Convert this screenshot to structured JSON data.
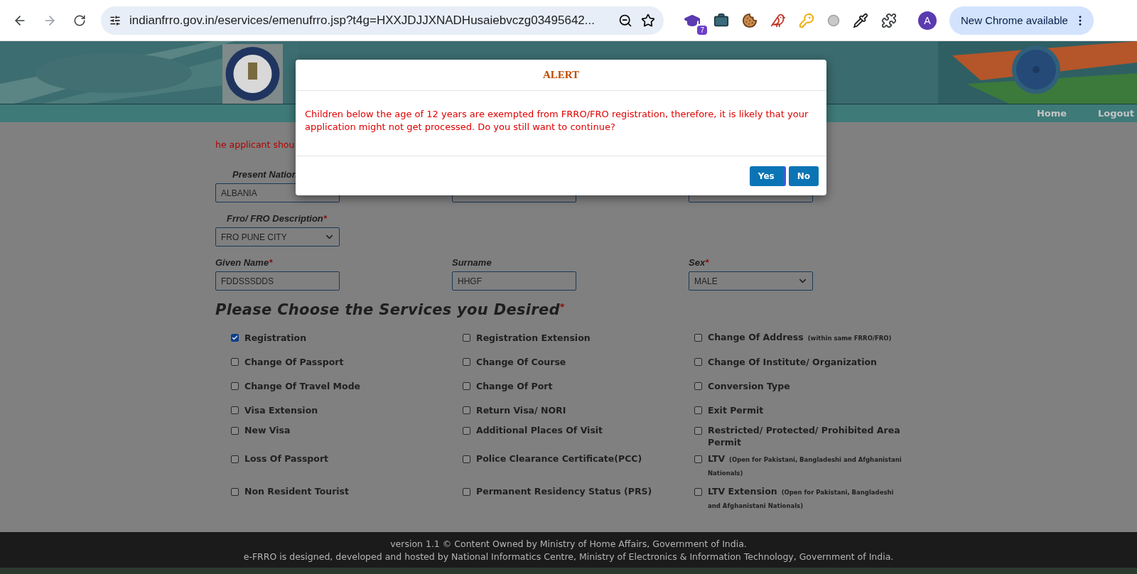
{
  "browser": {
    "url": "indianfrro.gov.in/eservices/emenufrro.jsp?t4g=HXXJDJJXNADHusaiebvczg03495642...",
    "extension_badge": "7",
    "avatar": "A",
    "update_button": "New Chrome available"
  },
  "nav": [
    {
      "label": "Home"
    },
    {
      "label": "Logout"
    }
  ],
  "notice": "he applicant shou",
  "fields": [
    {
      "kind": "input",
      "label": "Present Nation",
      "value": "ALBANIA"
    },
    {
      "kind": "input"
    },
    {
      "kind": "input"
    },
    {
      "kind": "select",
      "label": "Frro/ FRO Description",
      "required_mark": "*",
      "value": "FRO PUNE CITY"
    },
    {
      "kind": "none"
    },
    {
      "kind": "none"
    },
    {
      "kind": "input",
      "label": "Given Name",
      "required_mark": "*",
      "value": "FDDSSSDDS"
    },
    {
      "kind": "input",
      "label": "Surname",
      "value": "HHGF"
    },
    {
      "kind": "select",
      "label": "Sex",
      "required_mark": "*",
      "value": "MALE"
    }
  ],
  "services": {
    "heading": "Please Choose the Services you Desired",
    "required_mark": "*",
    "items": [
      {
        "label": "Registration",
        "checked": true
      },
      {
        "label": "Registration Extension",
        "checked": false
      },
      {
        "label": "Change Of Address",
        "note": "(within same FRRO/FRO)",
        "checked": false
      },
      {
        "label": "Change Of Passport",
        "checked": false
      },
      {
        "label": "Change Of Course",
        "checked": false
      },
      {
        "label": "Change Of Institute/ Organization",
        "checked": false
      },
      {
        "label": "Change Of Travel Mode",
        "checked": false
      },
      {
        "label": "Change Of Port",
        "checked": false
      },
      {
        "label": "Conversion Type",
        "checked": false
      },
      {
        "label": "Visa Extension",
        "checked": false
      },
      {
        "label": "Return Visa/ NORI",
        "checked": false
      },
      {
        "label": "Exit Permit",
        "checked": false
      },
      {
        "label": "New Visa",
        "checked": false
      },
      {
        "label": "Additional Places Of Visit",
        "checked": false
      },
      {
        "label": "Restricted/ Protected/ Prohibited Area Permit",
        "checked": false
      },
      {
        "label": "Loss Of Passport",
        "checked": false
      },
      {
        "label": "Police Clearance Certificate(PCC)",
        "checked": false
      },
      {
        "label": "LTV",
        "note": "(Open for Pakistani, Bangladeshi and Afghanistani Nationals)",
        "checked": false
      },
      {
        "label": "Non Resident Tourist",
        "checked": false
      },
      {
        "label": "Permanent Residency Status (PRS)",
        "checked": false
      },
      {
        "label": "LTV Extension",
        "note": "(Open for Pakistani, Bangladeshi and Afghanistani Nationals)",
        "checked": false
      }
    ]
  },
  "footer": [
    "version 1.1 © Content Owned by Ministry of Home Affairs, Government of India.",
    "e-FRRO is designed, developed and hosted by National Informatics Centre, Ministry of Electronics & Information Technology, Government of India."
  ],
  "alert": {
    "title": "ALERT",
    "message": "Children below the age of 12 years are exempted from FRRO/FRO registration, therefore, it is likely that your application might not get processed. Do you still want to continue?",
    "buttons": [
      {
        "label": "Yes",
        "selected": true
      },
      {
        "label": "No",
        "selected": false
      }
    ]
  }
}
